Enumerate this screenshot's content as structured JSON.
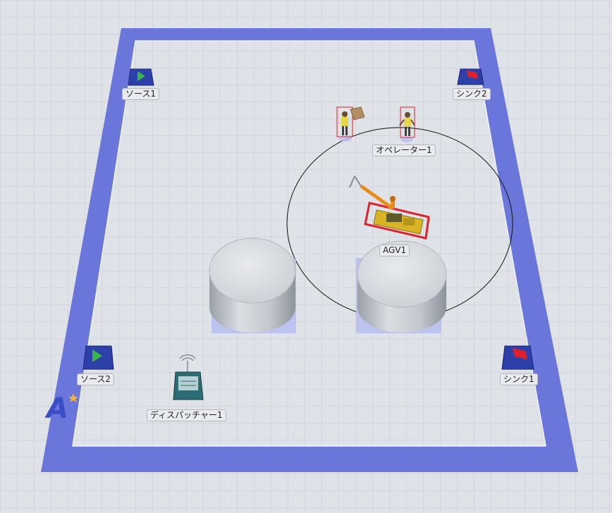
{
  "scene": {
    "objects": [
      {
        "id": "source1",
        "label": "ソース1",
        "type": "source"
      },
      {
        "id": "sink2",
        "label": "シンク2",
        "type": "sink"
      },
      {
        "id": "operator1",
        "label": "オペレーター1",
        "type": "operator"
      },
      {
        "id": "agv1",
        "label": "AGV1",
        "type": "agv"
      },
      {
        "id": "source2",
        "label": "ソース2",
        "type": "source"
      },
      {
        "id": "dispatcher1",
        "label": "ディスパッチャー1",
        "type": "dispatcher"
      },
      {
        "id": "sink1",
        "label": "シンク1",
        "type": "sink"
      }
    ]
  },
  "colors": {
    "background": "#dfe2e6",
    "grid": "#c7cbd1",
    "path": "#6b76db",
    "floor": "#e0e3e7",
    "tank": "#d3d6da",
    "tank_base": "#b9c0f0",
    "source_arrow": "#3bb54a",
    "sink_flag": "#e0202a",
    "box_blue": "#2d3fa8",
    "operator_bbox": "#e0202a",
    "agv_yellow": "#d8b325",
    "logo": "#3a4fc6",
    "star": "#f2b233"
  },
  "icons": {
    "logo": "a-star-logo-icon"
  }
}
